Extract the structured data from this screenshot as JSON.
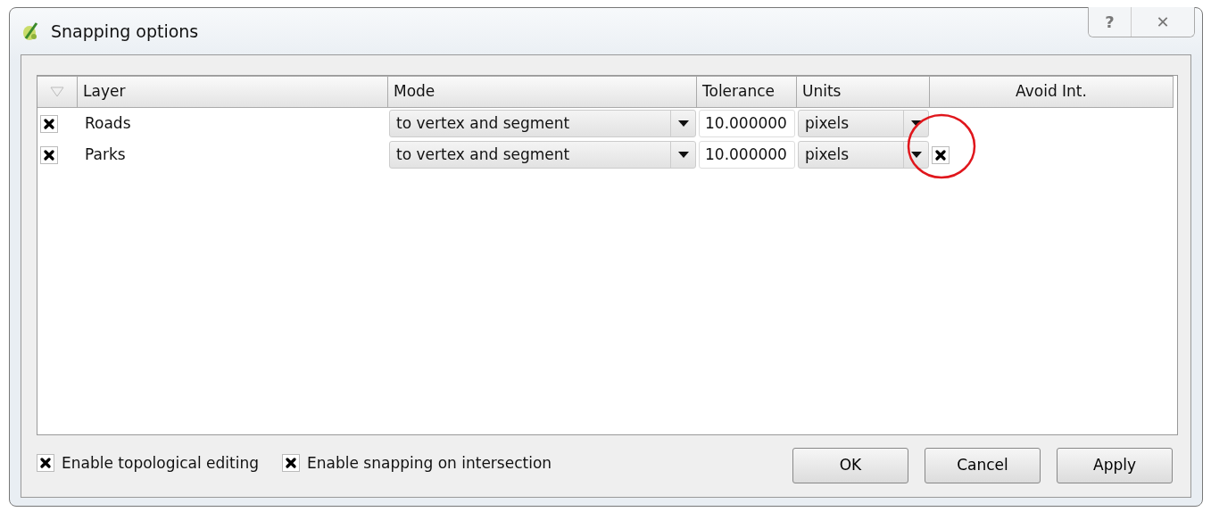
{
  "window": {
    "title": "Snapping options",
    "buttons": [
      {
        "kind": "help",
        "label": "?"
      },
      {
        "kind": "close",
        "label": "✕"
      }
    ]
  },
  "table": {
    "columns": [
      "Layer",
      "Mode",
      "Tolerance",
      "Units",
      "Avoid Int."
    ],
    "rows": [
      {
        "checked": true,
        "layer": "Roads",
        "mode": "to vertex and segment",
        "tolerance": "10.000000",
        "units": "pixels",
        "highlighted": false
      },
      {
        "checked": true,
        "layer": "Parks",
        "mode": "to vertex and segment",
        "tolerance": "10.000000",
        "units": "pixels",
        "avoid_int": {
          "checked": true
        },
        "highlighted": true
      }
    ]
  },
  "options": [
    {
      "label": "Enable topological editing",
      "checked": true
    },
    {
      "label": "Enable snapping on intersection",
      "checked": true
    }
  ],
  "buttons": [
    "OK",
    "Cancel",
    "Apply"
  ]
}
